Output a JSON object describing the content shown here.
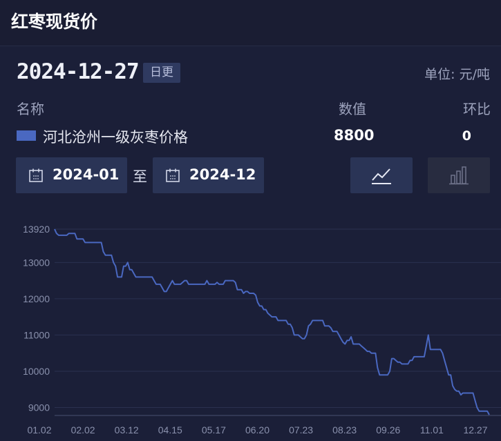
{
  "header": {
    "title": "红枣现货价"
  },
  "summary": {
    "date": "2024-12-27",
    "update_badge": "日更",
    "unit": "单位: 元/吨"
  },
  "table": {
    "columns": {
      "name": "名称",
      "value": "数值",
      "change": "环比"
    },
    "row": {
      "name": "河北沧州一级灰枣价格",
      "value": "8800",
      "change": "0",
      "color": "#4a68c1"
    }
  },
  "range": {
    "start": "2024-01",
    "separator": "至",
    "end": "2024-12"
  },
  "chart_toggle": {
    "line_icon": "line-chart-icon",
    "bar_icon": "bar-chart-icon",
    "active": "line"
  },
  "chart_data": {
    "type": "line",
    "title": "",
    "xlabel": "",
    "ylabel": "",
    "ylim": [
      8800,
      13920
    ],
    "yticks": [
      "13920",
      "13000",
      "12000",
      "11000",
      "10000",
      "9000"
    ],
    "ytick_values": [
      13920,
      13000,
      12000,
      11000,
      10000,
      9000
    ],
    "xticks": [
      "01.02",
      "02.02",
      "03.12",
      "04.15",
      "05.17",
      "06.20",
      "07.23",
      "08.23",
      "09.26",
      "11.01",
      "12.27"
    ],
    "grid": true,
    "series": [
      {
        "color": "#4a68c1",
        "values": [
          13920,
          13800,
          13750,
          13750,
          13750,
          13750,
          13750,
          13800,
          13800,
          13800,
          13800,
          13650,
          13650,
          13650,
          13650,
          13550,
          13550,
          13550,
          13550,
          13550,
          13550,
          13550,
          13550,
          13550,
          13300,
          13200,
          13200,
          13200,
          13200,
          13000,
          12900,
          12600,
          12600,
          12600,
          12900,
          12900,
          13000,
          12800,
          12800,
          12700,
          12600,
          12600,
          12600,
          12600,
          12600,
          12600,
          12600,
          12600,
          12600,
          12500,
          12400,
          12400,
          12400,
          12300,
          12200,
          12200,
          12300,
          12400,
          12500,
          12400,
          12400,
          12400,
          12400,
          12450,
          12500,
          12500,
          12400,
          12400,
          12400,
          12400,
          12400,
          12400,
          12400,
          12400,
          12400,
          12500,
          12400,
          12400,
          12400,
          12400,
          12450,
          12400,
          12400,
          12400,
          12500,
          12500,
          12500,
          12500,
          12500,
          12450,
          12250,
          12250,
          12250,
          12150,
          12200,
          12200,
          12150,
          12150,
          12150,
          12100,
          11900,
          11800,
          11800,
          11700,
          11700,
          11600,
          11550,
          11500,
          11500,
          11500,
          11400,
          11400,
          11400,
          11400,
          11400,
          11300,
          11300,
          11200,
          11000,
          11000,
          11000,
          10950,
          10900,
          10900,
          11000,
          11250,
          11300,
          11400,
          11400,
          11400,
          11400,
          11400,
          11400,
          11250,
          11250,
          11250,
          11200,
          11100,
          11100,
          11100,
          11000,
          10900,
          10800,
          10750,
          10850,
          10850,
          10950,
          10750,
          10750,
          10750,
          10750,
          10700,
          10650,
          10600,
          10550,
          10550,
          10500,
          10500,
          10500,
          10100,
          9900,
          9900,
          9900,
          9900,
          9900,
          10000,
          10350,
          10350,
          10300,
          10250,
          10250,
          10200,
          10200,
          10200,
          10200,
          10300,
          10300,
          10400,
          10400,
          10400,
          10400,
          10400,
          10400,
          10700,
          11000,
          10600,
          10600,
          10600,
          10600,
          10600,
          10600,
          10500,
          10300,
          10100,
          9900,
          9900,
          9600,
          9500,
          9450,
          9450,
          9350,
          9400,
          9400,
          9400,
          9400,
          9400,
          9400,
          9200,
          9000,
          8900,
          8900,
          8900,
          8900,
          8900,
          8800
        ]
      }
    ]
  }
}
